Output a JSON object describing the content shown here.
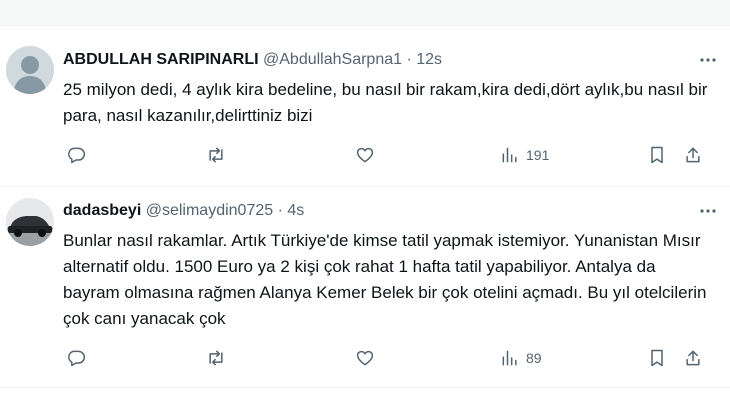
{
  "tweets": [
    {
      "author_name": "ABDULLAH SARIPINARLI",
      "handle": "@AbdullahSarpna1",
      "separator": "·",
      "time": "12s",
      "text": "25 milyon dedi, 4 aylık kira bedeline, bu nasıl bir rakam,kira dedi,dört aylık,bu nasıl bir para, nasıl kazanılır,delirttiniz bizi",
      "views": "191",
      "icons": [
        "default-avatar-icon",
        "more-icon",
        "reply-icon",
        "retweet-icon",
        "like-icon",
        "views-icon",
        "bookmark-icon",
        "share-icon"
      ]
    },
    {
      "author_name": "dadasbeyi",
      "handle": "@selimaydin0725",
      "separator": "·",
      "time": "4s",
      "text": "Bunlar nasıl rakamlar. Artık Türkiye'de kimse tatil yapmak istemiyor. Yunanistan Mısır alternatif oldu. 1500 Euro ya 2 kişi çok rahat 1 hafta tatil yapabiliyor. Antalya da bayram olmasına rağmen Alanya Kemer Belek bir çok otelini açmadı. Bu yıl otelcilerin çok canı yanacak çok",
      "views": "89",
      "icons": [
        "car-photo-avatar",
        "more-icon",
        "reply-icon",
        "retweet-icon",
        "like-icon",
        "views-icon",
        "bookmark-icon",
        "share-icon"
      ]
    }
  ],
  "colors": {
    "text_primary": "#0f1419",
    "text_secondary": "#536471",
    "divider": "#eff3f4",
    "default_avatar_bg": "#cfd9de"
  }
}
